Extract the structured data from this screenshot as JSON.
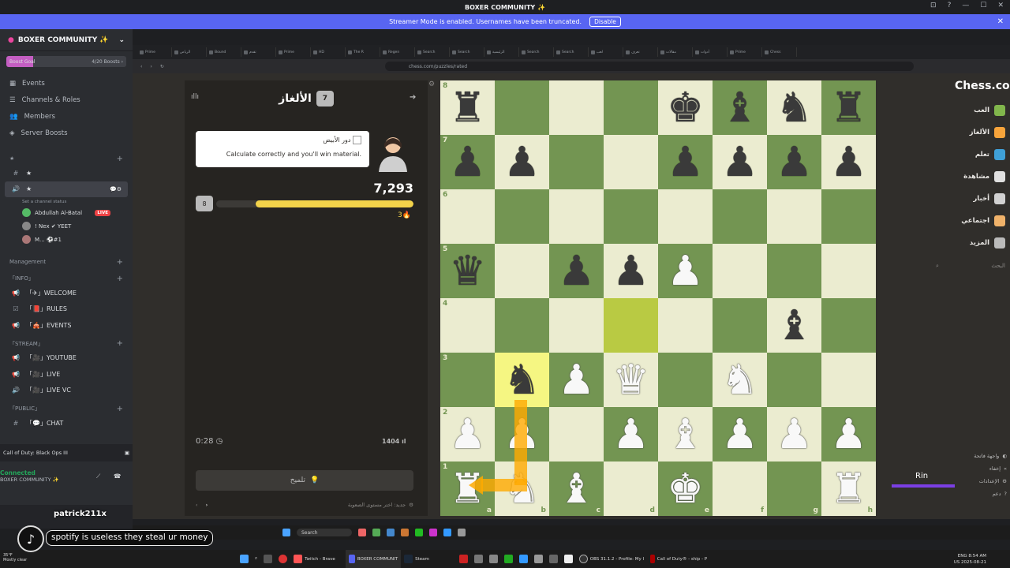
{
  "window": {
    "title": "BOXER COMMUNITY ✨",
    "controls": [
      "⊡",
      "?",
      "—",
      "☐",
      "✕"
    ]
  },
  "streamer_mode": {
    "text": "Streamer Mode is enabled. Usernames have been truncated.",
    "button": "Disable"
  },
  "server": {
    "name": "BOXER COMMUNITY ✨",
    "boost_goal": "Boost Goal",
    "boost_count": "4/20 Boosts ›",
    "boost_progress": 0.2,
    "nav": [
      {
        "label": "Events",
        "icon": "calendar-icon"
      },
      {
        "label": "Channels & Roles",
        "icon": "list-icon"
      },
      {
        "label": "Members",
        "icon": "members-icon"
      },
      {
        "label": "Server Boosts",
        "icon": "boost-icon"
      }
    ],
    "star_category": "★",
    "star_channel": "★",
    "voice_channel": "★",
    "voice_status": "Set a channel status",
    "voice_users": [
      {
        "name": "Abdullah Al-Batal",
        "badge": "LIVE"
      },
      {
        "name": "! Nex ✔ YEET"
      },
      {
        "name": "M... ⚽#1"
      }
    ],
    "management_label": "Management",
    "categories": [
      {
        "name": "「INFO」",
        "channels": [
          "「✈」WELCOME",
          "「📕」RULES",
          "「🎪」EVENTS"
        ]
      },
      {
        "name": "「STREAM」",
        "channels": [
          "「🎥」YOUTUBE",
          "「🎥」LIVE",
          "「🎥」LIVE VC"
        ]
      },
      {
        "name": "「PUBLIC」",
        "channels": [
          "「💬」CHAT"
        ]
      }
    ]
  },
  "activity": "Call of Duty: Black Ops III",
  "voice_connected": {
    "status": "Connected",
    "channel": "BOXER COMMUNITY ✨"
  },
  "browser": {
    "tabs": [
      "Prime",
      "الرياض",
      "Bound",
      "تقدم",
      "Prime",
      "HD",
      "The R",
      "Regen",
      "Search",
      "Search",
      "الرئيسية",
      "Search",
      "Search",
      "لعب",
      "تعرف",
      "مقالات",
      "أدوات",
      "Prime",
      "Chess"
    ],
    "url": "chess.com/puzzles/rated"
  },
  "puzzle": {
    "header": "الألغاز",
    "streak_badge": "7",
    "turn_label": "دور الأبيض",
    "hint_text": "Calculate correctly and you'll win material.",
    "score": "7,293",
    "lives": "3",
    "progress_badge": "8",
    "progress": 0.8,
    "timer": "0:28",
    "rating": "1404",
    "hint_button": "تلميح",
    "footer": "جديد: اختر مستوى الصعوبة"
  },
  "board": {
    "ranks": [
      "8",
      "7",
      "6",
      "5",
      "4",
      "3",
      "2",
      "1"
    ],
    "files": [
      "a",
      "b",
      "c",
      "d",
      "e",
      "f",
      "g",
      "h"
    ],
    "rows": [
      [
        "bR",
        "",
        "",
        "",
        "bK",
        "bB",
        "bN",
        "bR"
      ],
      [
        "bP",
        "bP",
        "",
        "",
        "bP",
        "bP",
        "bP",
        "bP"
      ],
      [
        "",
        "",
        "",
        "",
        "",
        "",
        "",
        ""
      ],
      [
        "bQ",
        "",
        "bP",
        "bP",
        "wP",
        "",
        "",
        ""
      ],
      [
        "",
        "",
        "",
        "",
        "",
        "",
        "bB",
        ""
      ],
      [
        "",
        "bN",
        "wP",
        "wQ",
        "",
        "wN",
        "",
        ""
      ],
      [
        "wP",
        "wP",
        "",
        "wP",
        "wB",
        "wP",
        "wP",
        "wP"
      ],
      [
        "wR",
        "wN",
        "wB",
        "",
        "wK",
        "",
        "",
        "wR"
      ]
    ],
    "highlight_squares": [
      "b3",
      "d4"
    ]
  },
  "chess_nav": {
    "logo": "Chess.com",
    "items": [
      {
        "label": "العب",
        "color": "#81b64c"
      },
      {
        "label": "الألغاز",
        "color": "#f7a43b"
      },
      {
        "label": "تعلم",
        "color": "#3fa0d7"
      },
      {
        "label": "مشاهدة",
        "color": "#e0e0e0"
      },
      {
        "label": "أخبار",
        "color": "#d1d1d1"
      },
      {
        "label": "اجتماعي",
        "color": "#f0b26a"
      },
      {
        "label": "المزيد",
        "color": "#bababa"
      }
    ],
    "search_placeholder": "البحث"
  },
  "settings": [
    "واجهة فاتحة",
    "إخفاء",
    "الإعدادات",
    "دعم"
  ],
  "overlay_name": "Rin",
  "inner_taskbar": {
    "search": "Search",
    "items": [
      "Twitch - Brave",
      "BOXER COMMUNI...",
      "Steam",
      "OBS 31.1.2 - Profile: My",
      "Call of Duty® - ship"
    ]
  },
  "chat": {
    "user": "patrick211x",
    "message": "spotify is useless they steal ur money"
  },
  "taskbar": {
    "weather_temp": "35°F",
    "weather_desc": "Mostly clear",
    "apps": [
      "Twitch - Brave",
      "BOXER COMMUNIT",
      "Steam",
      "OBS 31.1.2 - Profile: My I",
      "Call of Duty® - ship - P"
    ],
    "lang": "ENG",
    "lang_sub": "US",
    "time": "8:54 AM",
    "date": "2025-08-21"
  }
}
